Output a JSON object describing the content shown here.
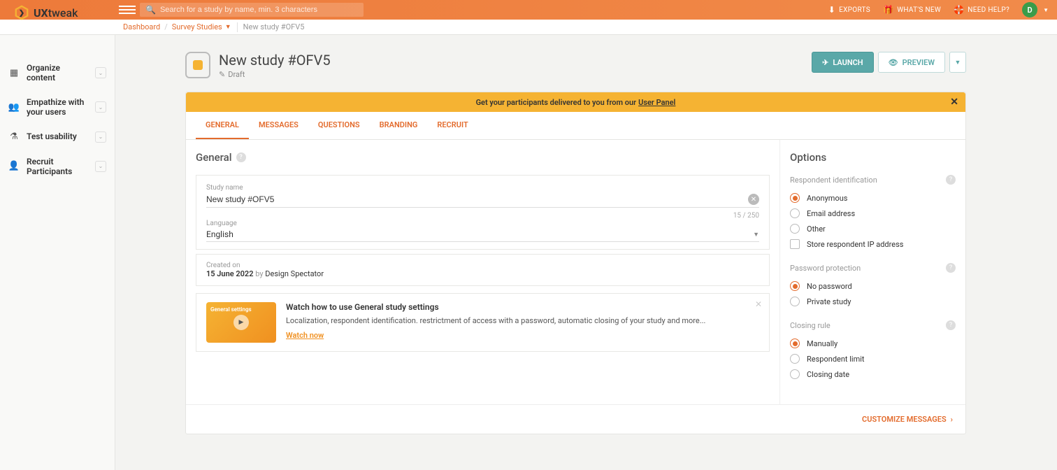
{
  "logo": {
    "brand_a": "UX",
    "brand_b": "tweak"
  },
  "topbar": {
    "search_placeholder": "Search for a study by name, min. 3 characters",
    "exports": "EXPORTS",
    "whats_new": "WHAT'S NEW",
    "need_help": "NEED HELP?",
    "user_initial": "D"
  },
  "breadcrumb": {
    "dashboard": "Dashboard",
    "studies": "Survey Studies",
    "current": "New study #OFV5"
  },
  "sidebar": {
    "items": [
      {
        "label": "Organize content"
      },
      {
        "label": "Empathize with your users"
      },
      {
        "label": "Test usability"
      },
      {
        "label": "Recruit Participants"
      }
    ]
  },
  "study": {
    "title": "New study #OFV5",
    "status": "Draft"
  },
  "actions": {
    "launch": "LAUNCH",
    "preview": "PREVIEW"
  },
  "banner": {
    "text_a": "Get your participants delivered to you from our ",
    "link": "User Panel"
  },
  "tabs": {
    "general": "GENERAL",
    "messages": "MESSAGES",
    "questions": "QUESTIONS",
    "branding": "BRANDING",
    "recruit": "RECRUIT"
  },
  "general": {
    "heading": "General",
    "study_name_label": "Study name",
    "study_name_value": "New study #OFV5",
    "char_count": "15 / 250",
    "language_label": "Language",
    "language_value": "English",
    "created_label": "Created on",
    "created_date": "15 June 2022",
    "created_by_prefix": " by ",
    "created_by": "Design Spectator",
    "video_title": "Watch how to use General study settings",
    "video_desc": "Localization, respondent identification. restrictment of access with a password, automatic closing of your study and more...",
    "video_watch": "Watch now",
    "video_thumb": "General settings"
  },
  "options": {
    "heading": "Options",
    "respondent_id": "Respondent identification",
    "anonymous": "Anonymous",
    "email": "Email address",
    "other": "Other",
    "store_ip": "Store respondent IP address",
    "password_prot": "Password protection",
    "no_password": "No password",
    "private_study": "Private study",
    "closing_rule": "Closing rule",
    "manually": "Manually",
    "respondent_limit": "Respondent limit",
    "closing_date": "Closing date"
  },
  "footer": {
    "customize": "CUSTOMIZE MESSAGES"
  }
}
